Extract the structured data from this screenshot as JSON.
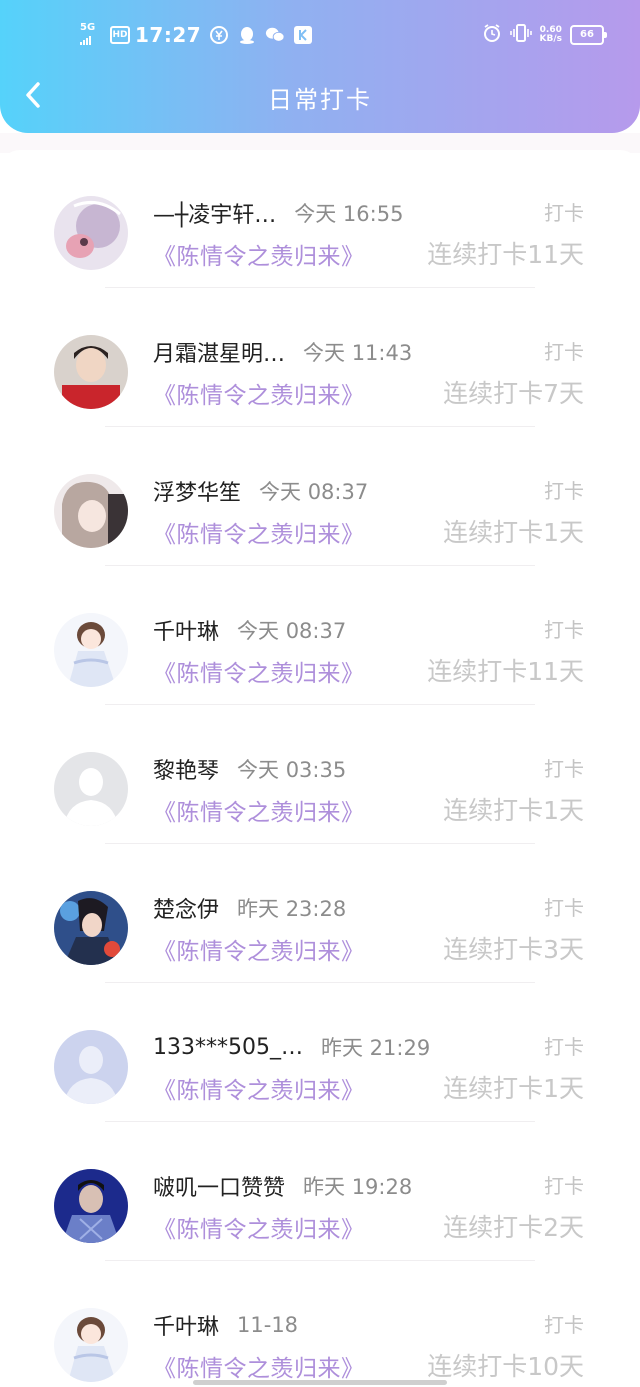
{
  "status_bar": {
    "network": "5G",
    "hd": "HD",
    "time": "17:27",
    "speed_value": "0.60",
    "speed_unit": "KB/s",
    "battery": "66",
    "icons": [
      "pay-icon",
      "qq-icon",
      "wechat-icon",
      "k-app-icon",
      "alarm-icon",
      "vibrate-icon"
    ]
  },
  "header": {
    "title": "日常打卡",
    "back_icon": "chevron-left-icon",
    "gradient": [
      "#55d2fa",
      "#b69aec"
    ]
  },
  "colors": {
    "book_title": "#ae8fdb",
    "streak": "#c8c8c8",
    "time": "#8c8c8c"
  },
  "list": {
    "items": [
      {
        "name": "—┼凌宇轩…",
        "time": "今天 16:55",
        "action": "打卡",
        "book": "《陈情令之羡归来》",
        "streak": "连续打卡11天",
        "avatar": "anime-pink-avatar"
      },
      {
        "name": "月霜湛星明…",
        "time": "今天 11:43",
        "action": "打卡",
        "book": "《陈情令之羡归来》",
        "streak": "连续打卡7天",
        "avatar": "boy-photo-avatar"
      },
      {
        "name": "浮梦华笙",
        "time": "今天 08:37",
        "action": "打卡",
        "book": "《陈情令之羡归来》",
        "streak": "连续打卡1天",
        "avatar": "anime-girl-avatar"
      },
      {
        "name": "千叶琳",
        "time": "今天 08:37",
        "action": "打卡",
        "book": "《陈情令之羡归来》",
        "streak": "连续打卡11天",
        "avatar": "chibi-avatar"
      },
      {
        "name": "黎艳琴",
        "time": "今天 03:35",
        "action": "打卡",
        "book": "《陈情令之羡归来》",
        "streak": "连续打卡1天",
        "avatar": "default-gray-avatar"
      },
      {
        "name": "楚念伊",
        "time": "昨天 23:28",
        "action": "打卡",
        "book": "《陈情令之羡归来》",
        "streak": "连续打卡3天",
        "avatar": "game-character-avatar"
      },
      {
        "name": "133***505_…",
        "time": "昨天 21:29",
        "action": "打卡",
        "book": "《陈情令之羡归来》",
        "streak": "连续打卡1天",
        "avatar": "default-blue-avatar"
      },
      {
        "name": "啵叽一口赞赞",
        "time": "昨天 19:28",
        "action": "打卡",
        "book": "《陈情令之羡归来》",
        "streak": "连续打卡2天",
        "avatar": "boy-night-avatar"
      },
      {
        "name": "千叶琳",
        "time": "11-18",
        "action": "打卡",
        "book": "《陈情令之羡归来》",
        "streak": "连续打卡10天",
        "avatar": "chibi-avatar"
      }
    ]
  }
}
